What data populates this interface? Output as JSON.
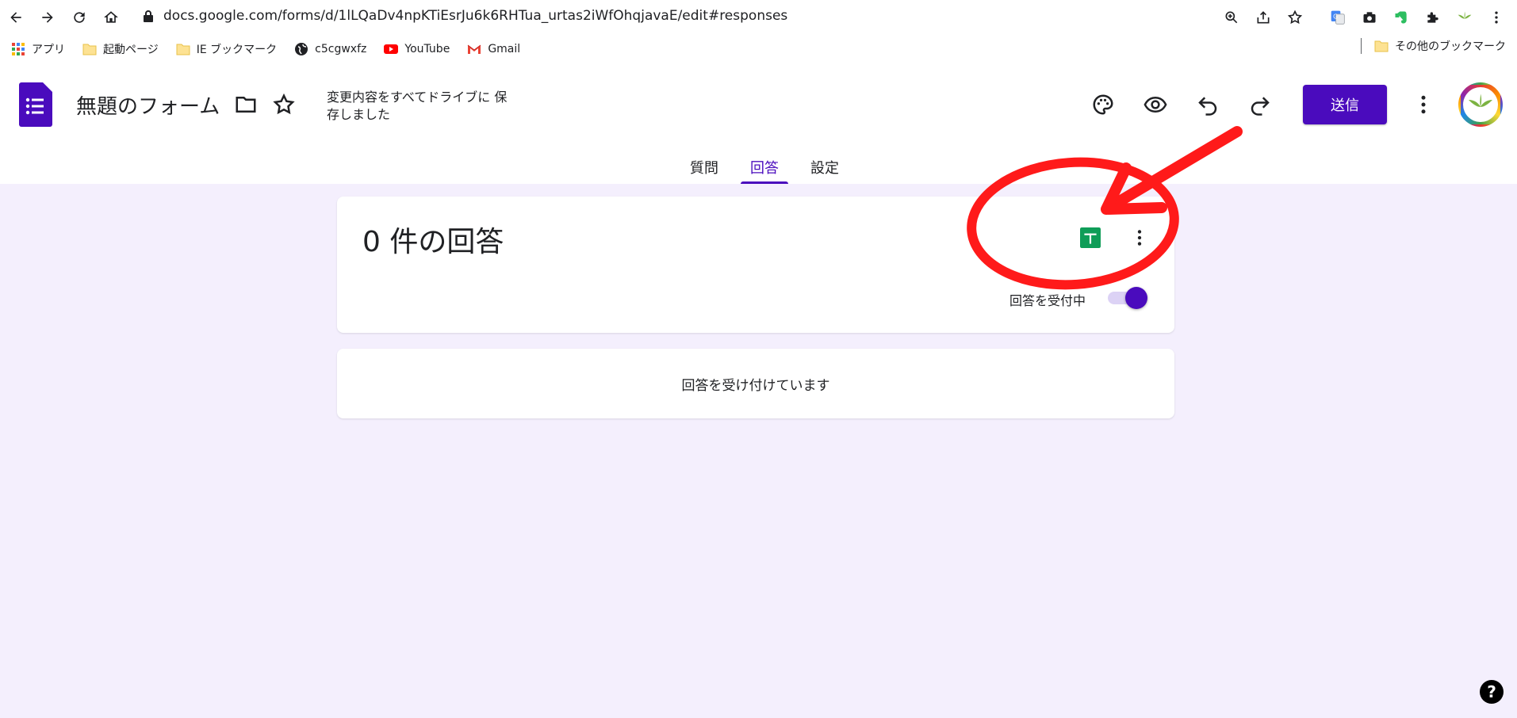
{
  "browser": {
    "url": "docs.google.com/forms/d/1lLQaDv4npKTiEsrJu6k6RHTua_urtas2iWfOhqjavaE/edit#responses",
    "bookmarks": [
      {
        "label": "アプリ",
        "icon": "apps-grid-icon"
      },
      {
        "label": "起動ページ",
        "icon": "folder-icon"
      },
      {
        "label": "IE ブックマーク",
        "icon": "folder-icon"
      },
      {
        "label": "c5cgwxfz",
        "icon": "globe-icon"
      },
      {
        "label": "YouTube",
        "icon": "youtube-icon"
      },
      {
        "label": "Gmail",
        "icon": "gmail-icon"
      }
    ],
    "other_bookmarks": "その他のブックマーク"
  },
  "form": {
    "title": "無題のフォーム",
    "save_status": "変更内容をすべてドライブに 保存しました",
    "send_label": "送信",
    "tabs": [
      {
        "label": "質問",
        "active": false
      },
      {
        "label": "回答",
        "active": true
      },
      {
        "label": "設定",
        "active": false
      }
    ]
  },
  "responses": {
    "count_text": "0 件の回答",
    "accepting_label": "回答を受付中",
    "accepting": true,
    "status_message": "回答を受け付けています"
  },
  "colors": {
    "brand_purple": "#4a0bbd",
    "page_bg": "#f4effd",
    "sheets_green": "#0f9d58",
    "annotation_red": "#ff1a1a"
  }
}
